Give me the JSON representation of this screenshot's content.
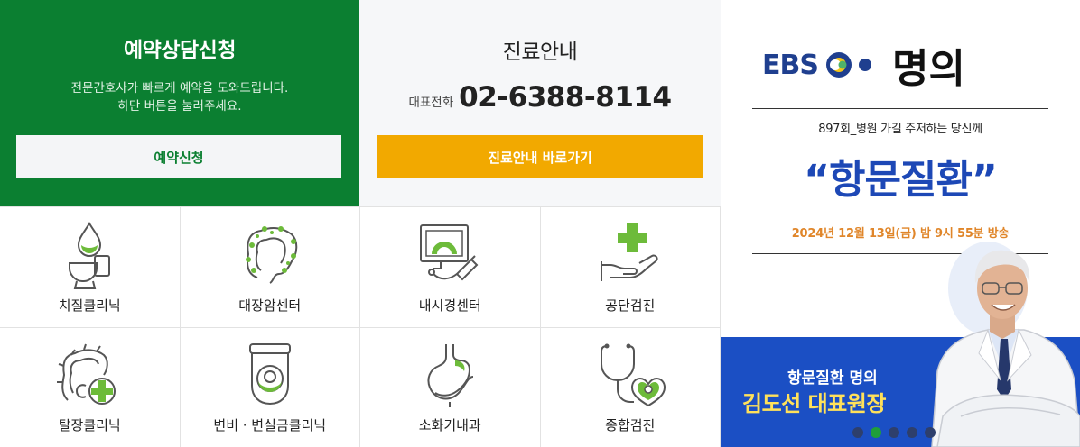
{
  "reservation": {
    "title": "예약상담신청",
    "desc_line1": "전문간호사가 빠르게 예약을 도와드립니다.",
    "desc_line2": "하단 버튼을 눌러주세요.",
    "button_label": "예약신청"
  },
  "info": {
    "title": "진료안내",
    "phone_label": "대표전화",
    "phone_number": "02-6388-8114",
    "button_label": "진료안내 바로가기"
  },
  "services": [
    {
      "label": "치질클리닉",
      "icon": "toilet-drop-icon"
    },
    {
      "label": "대장암센터",
      "icon": "colon-icon"
    },
    {
      "label": "내시경센터",
      "icon": "endoscope-monitor-icon"
    },
    {
      "label": "공단검진",
      "icon": "hand-cross-icon"
    },
    {
      "label": "탈장클리닉",
      "icon": "intestine-cross-icon"
    },
    {
      "label": "변비 · 변실금클리닉",
      "icon": "toilet-bowl-icon"
    },
    {
      "label": "소화기내과",
      "icon": "stomach-icon"
    },
    {
      "label": "종합검진",
      "icon": "stethoscope-heart-icon"
    }
  ],
  "banner": {
    "ebs": "EBS",
    "program": "명의",
    "episode": "897회_병원 가길 주저하는 당신께",
    "topic": "“항문질환”",
    "date": "2024년 12월 13일(금) 밤 9시 55분 방송",
    "caption1": "항문질환 명의",
    "caption2": "김도선 대표원장",
    "slide_count": 5,
    "active_slide": 2
  },
  "colors": {
    "green": "#0b7f31",
    "orange": "#f2a900",
    "icon_green": "#6dbb3a",
    "banner_blue": "#1b4fc4",
    "topic_blue": "#1d48b6",
    "date_orange": "#e0862a"
  }
}
